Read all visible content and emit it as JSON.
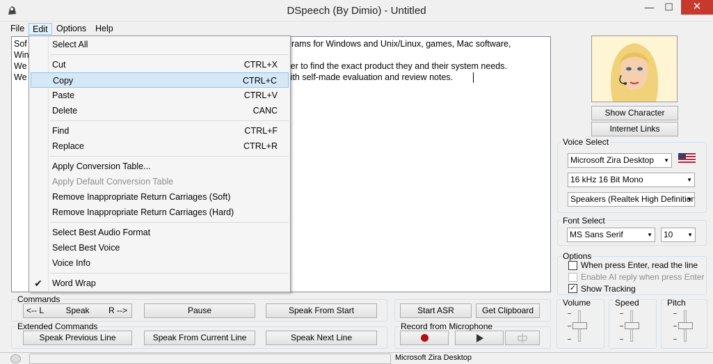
{
  "window": {
    "title": "DSpeech (By Dimio) - Untitled",
    "minimize_glyph": "—",
    "maximize_glyph": "☐",
    "close_glyph": "✕"
  },
  "menubar": {
    "file": "File",
    "edit": "Edit",
    "options": "Options",
    "help": "Help"
  },
  "editor": {
    "lines_visible": [
      "Sof",
      "Win",
      "We",
      "We"
    ],
    "lines_right": [
      "rograms for Windows and Unix/Linux, games, Mac software,",
      "",
      "/user to find the exact product they and their system needs.",
      "r with self-made evaluation and review notes."
    ]
  },
  "edit_menu": {
    "select_all": "Select All",
    "cut": "Cut",
    "cut_sc": "CTRL+X",
    "copy": "Copy",
    "copy_sc": "CTRL+C",
    "paste": "Paste",
    "paste_sc": "CTRL+V",
    "delete": "Delete",
    "delete_sc": "CANC",
    "find": "Find",
    "find_sc": "CTRL+F",
    "replace": "Replace",
    "replace_sc": "CTRL+R",
    "apply_conversion": "Apply Conversion Table...",
    "apply_default_conversion": "Apply Default Conversion Table",
    "remove_soft": "Remove Inappropriate Return Carriages (Soft)",
    "remove_hard": "Remove Inappropriate Return Carriages (Hard)",
    "best_audio": "Select Best Audio Format",
    "best_voice": "Select Best Voice",
    "voice_info": "Voice Info",
    "word_wrap": "Word Wrap",
    "word_wrap_checked": true
  },
  "character": {
    "show_character": "Show Character",
    "internet_links": "Internet Links"
  },
  "voice_select": {
    "label": "Voice Select",
    "voice": "Microsoft Zira Desktop",
    "format": "16 kHz 16 Bit Mono",
    "device": "Speakers (Realtek High Definition A",
    "flag_icon": "us-flag-icon"
  },
  "font_select": {
    "label": "Font Select",
    "font": "MS Sans Serif",
    "size": "10"
  },
  "options": {
    "label": "Options",
    "enter_read_line": "When press Enter, read the line",
    "enable_ai_reply": "Enable AI reply when press Enter",
    "show_tracking": "Show Tracking",
    "enter_read_line_checked": false,
    "enable_ai_reply_checked": false,
    "show_tracking_checked": true
  },
  "commands": {
    "label": "Commands",
    "prev": "<-- L",
    "speak": "Speak",
    "next": "R -->",
    "pause": "Pause",
    "speak_from_start": "Speak From Start"
  },
  "extended_commands": {
    "label": "Extended Commands",
    "speak_previous_line": "Speak Previous Line",
    "speak_from_current_line": "Speak From Current Line",
    "speak_next_line": "Speak Next Line"
  },
  "asr": {
    "start_asr": "Start ASR",
    "get_clipboard": "Get Clipboard"
  },
  "record": {
    "label": "Record from Microphone"
  },
  "sliders": {
    "volume": "Volume",
    "speed": "Speed",
    "pitch": "Pitch"
  },
  "status": {
    "voice": "Microsoft Zira Desktop"
  },
  "colors": {
    "close_red": "#c7382d",
    "menu_highlight": "#d5e8f8",
    "record_red": "#b01010"
  }
}
